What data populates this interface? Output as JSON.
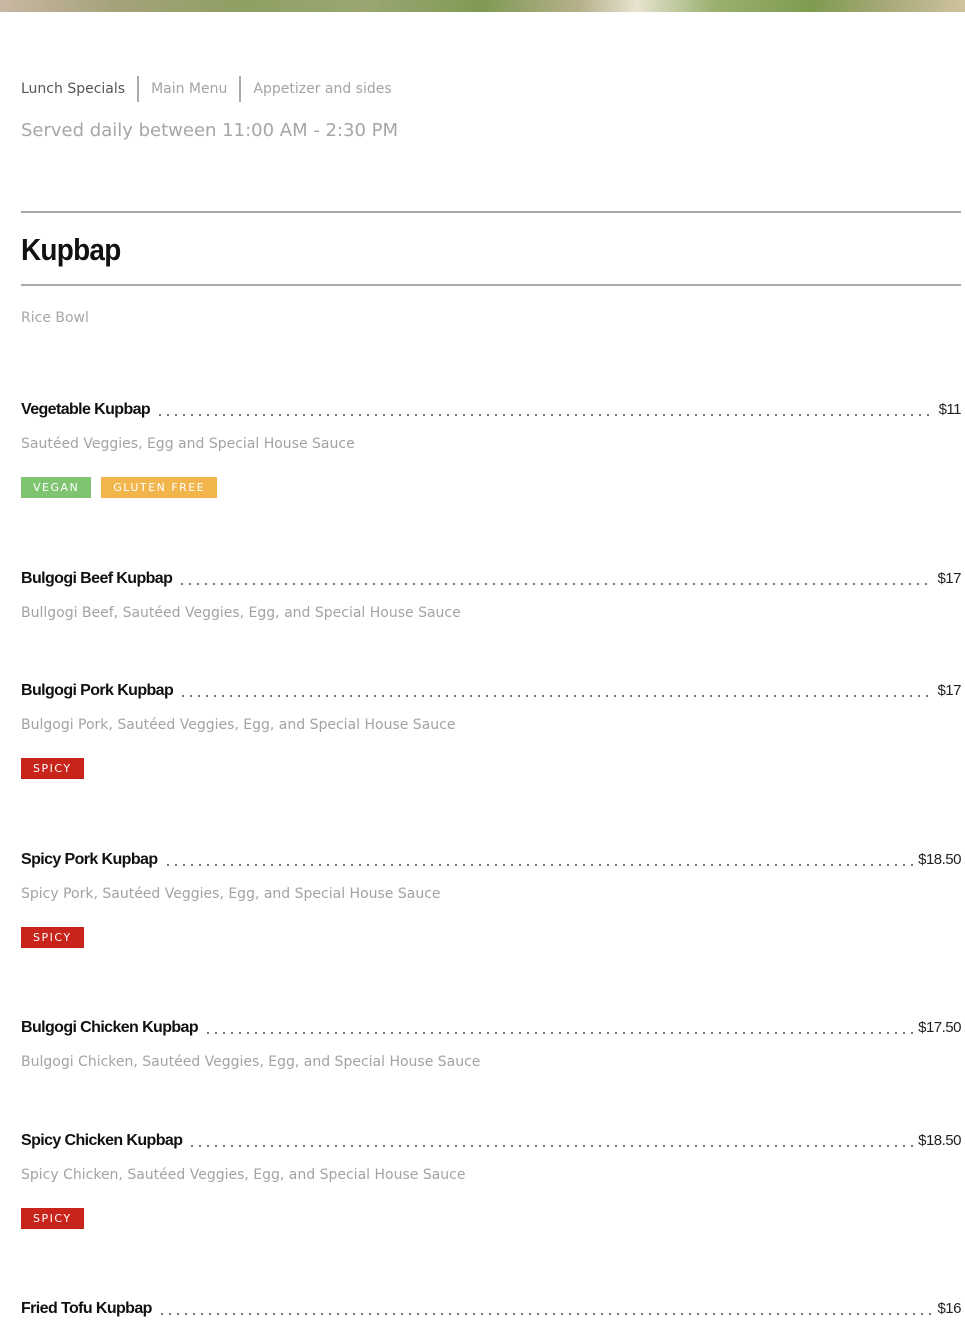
{
  "tabs": [
    {
      "label": "Lunch Specials",
      "active": true
    },
    {
      "label": "Main Menu",
      "active": false
    },
    {
      "label": "Appetizer and sides",
      "active": false
    }
  ],
  "served": "Served daily between 11:00 AM - 2:30 PM",
  "section": {
    "title": "Kupbap",
    "subtitle": "Rice Bowl"
  },
  "badge_colors": {
    "vegan": "#7ec471",
    "gluten_free": "#f2b54c",
    "spicy": "#c8241b"
  },
  "items": [
    {
      "name": "Vegetable Kupbap",
      "price": "$11",
      "description": "Sautéed Veggies, Egg and Special House Sauce",
      "badges": [
        {
          "label": "VEGAN",
          "type": "vegan"
        },
        {
          "label": "GLUTEN FREE",
          "type": "gluten_free"
        }
      ]
    },
    {
      "name": "Bulgogi Beef Kupbap",
      "price": "$17",
      "description": "Bullgogi Beef, Sautéed Veggies, Egg, and Special House Sauce",
      "badges": []
    },
    {
      "name": "Bulgogi Pork Kupbap",
      "price": "$17",
      "description": "Bulgogi Pork, Sautéed Veggies, Egg, and Special House Sauce",
      "badges": [
        {
          "label": "SPICY",
          "type": "spicy"
        }
      ]
    },
    {
      "name": "Spicy Pork Kupbap",
      "price": "$18.50",
      "description": "Spicy Pork, Sautéed Veggies, Egg, and Special House Sauce",
      "badges": [
        {
          "label": "SPICY",
          "type": "spicy"
        }
      ]
    },
    {
      "name": "Bulgogi Chicken Kupbap",
      "price": "$17.50",
      "description": "Bulgogi Chicken, Sautéed Veggies, Egg, and Special House Sauce",
      "badges": []
    },
    {
      "name": "Spicy Chicken Kupbap",
      "price": "$18.50",
      "description": "Spicy Chicken, Sautéed Veggies, Egg, and Special House Sauce",
      "badges": [
        {
          "label": "SPICY",
          "type": "spicy"
        }
      ]
    },
    {
      "name": "Fried Tofu Kupbap",
      "price": "$16",
      "description": "",
      "badges": []
    }
  ]
}
